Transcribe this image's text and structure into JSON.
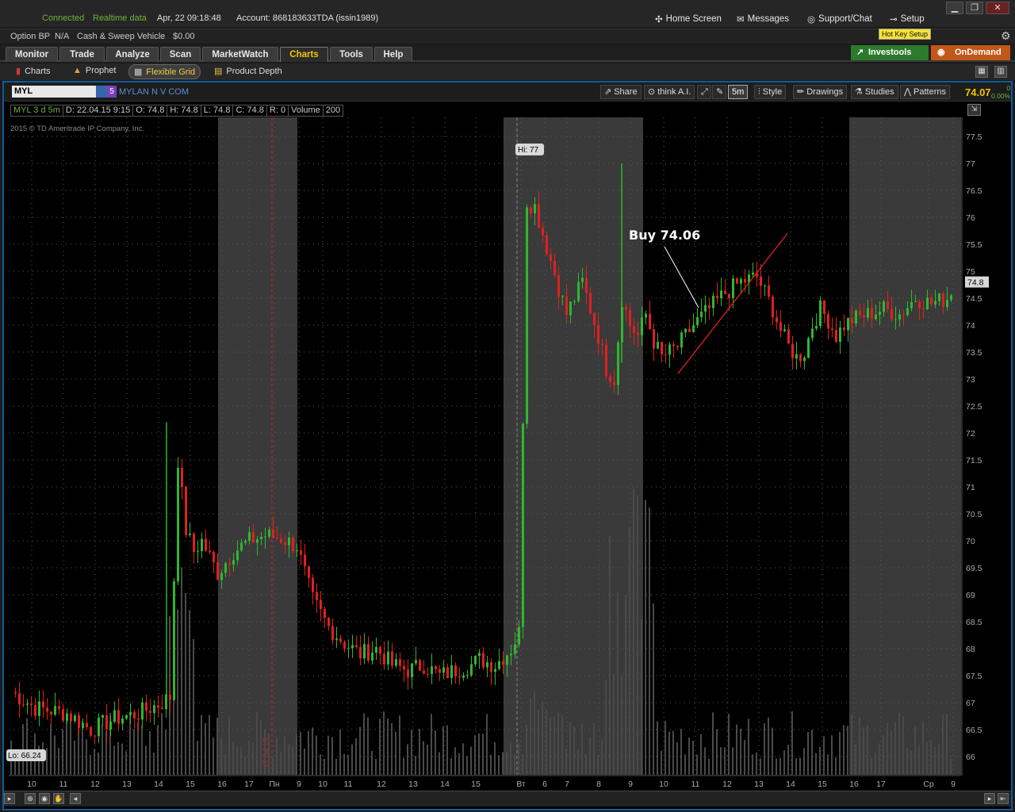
{
  "status": {
    "connected": "Connected",
    "realtime": "Realtime data",
    "datetime": "Apr, 22  09:18:48",
    "account": "Account: 868183633TDA (issin1989)"
  },
  "header_buttons": {
    "home": "Home Screen",
    "messages": "Messages",
    "support": "Support/Chat",
    "setup": "Setup"
  },
  "balance": {
    "option_bp_label": "Option BP",
    "option_bp_value": "N/A",
    "cash_label": "Cash & Sweep Vehicle",
    "cash_value": "$0.00",
    "hotkey": "Hot Key Setup"
  },
  "tabs": [
    "Monitor",
    "Trade",
    "Analyze",
    "Scan",
    "MarketWatch",
    "Charts",
    "Tools",
    "Help"
  ],
  "active_tab": "Charts",
  "ext_buttons": {
    "investools": "Investools",
    "ondemand": "OnDemand"
  },
  "subtabs": [
    "Charts",
    "Prophet",
    "Flexible Grid",
    "Product Depth"
  ],
  "chart_toolbar": {
    "symbol": "MYL",
    "symbol_badge": "5",
    "symbol_name": "MYLAN N V COM",
    "share": "Share",
    "thinkai": "think A.I.",
    "timeframe": "5m",
    "style": "Style",
    "drawings": "Drawings",
    "studies": "Studies",
    "patterns": "Patterns",
    "last_price": "74.07",
    "change": "0",
    "change_pct": "0.00%"
  },
  "ohlc_bar": {
    "label": "MYL 3 d 5m",
    "date": "D: 22.04.15 9:15",
    "open": "O: 74.8",
    "high": "H: 74.8",
    "low": "L: 74.8",
    "close": "C: 74.8",
    "range": "R: 0",
    "volume_label": "Volume",
    "volume_value": "200"
  },
  "copyright": "2015 © TD Ameritrade IP Company, Inc.",
  "chart_data": {
    "type": "candlestick",
    "symbol": "MYL",
    "interval": "5m",
    "y_ticks": [
      66,
      66.5,
      67,
      67.5,
      68,
      68.5,
      69,
      69.5,
      70,
      70.5,
      71,
      71.5,
      72,
      72.5,
      73,
      73.5,
      74,
      74.5,
      75,
      75.5,
      76,
      76.5,
      77,
      77.5
    ],
    "ylim": [
      65.7,
      78
    ],
    "x_ticks": [
      "10",
      "11",
      "12",
      "13",
      "14",
      "15",
      "16",
      "17",
      "Пн",
      "9",
      "10",
      "11",
      "12",
      "13",
      "14",
      "15",
      "Вт",
      "6",
      "7",
      "8",
      "9",
      "10",
      "11",
      "12",
      "13",
      "14",
      "15",
      "16",
      "17",
      "Ср",
      "9"
    ],
    "date_marker": "17.04.15",
    "hi_label": "Hi: 77",
    "lo_label": "Lo: 66.24",
    "current_price_label": "74.8",
    "annotation": "Buy 74.06",
    "close_path": [
      [
        0,
        67.2
      ],
      [
        3,
        66.9
      ],
      [
        7,
        66.8
      ],
      [
        10,
        66.5
      ],
      [
        13,
        66.7
      ],
      [
        16,
        66.8
      ],
      [
        19,
        67.0
      ],
      [
        20,
        67.1
      ],
      [
        21,
        71.5
      ],
      [
        22,
        70.2
      ],
      [
        23,
        69.8
      ],
      [
        24,
        70.0
      ],
      [
        26,
        69.4
      ],
      [
        28,
        69.8
      ],
      [
        30,
        70.0
      ],
      [
        32,
        70.1
      ],
      [
        34,
        70.05
      ],
      [
        36,
        69.9
      ],
      [
        37,
        69.4
      ],
      [
        38,
        68.9
      ],
      [
        40,
        68.4
      ],
      [
        42,
        68.1
      ],
      [
        44,
        67.9
      ],
      [
        46,
        68.0
      ],
      [
        48,
        67.7
      ],
      [
        50,
        67.6
      ],
      [
        52,
        67.7
      ],
      [
        54,
        67.5
      ],
      [
        56,
        67.6
      ],
      [
        58,
        67.7
      ],
      [
        59,
        67.8
      ],
      [
        61,
        67.7
      ],
      [
        63,
        68.0
      ],
      [
        64,
        68.3
      ],
      [
        65,
        76.3
      ],
      [
        66,
        76.2
      ],
      [
        68,
        75.2
      ],
      [
        70,
        74.2
      ],
      [
        72,
        74.8
      ],
      [
        74,
        73.8
      ],
      [
        75,
        73.2
      ],
      [
        76,
        73.0
      ],
      [
        77,
        74.5
      ],
      [
        78,
        74.0
      ],
      [
        79,
        73.8
      ],
      [
        80,
        74.2
      ],
      [
        81,
        73.7
      ],
      [
        82,
        73.4
      ],
      [
        84,
        73.6
      ],
      [
        86,
        74.0
      ],
      [
        88,
        74.3
      ],
      [
        90,
        74.6
      ],
      [
        92,
        74.8
      ],
      [
        94,
        74.9
      ],
      [
        95,
        74.6
      ],
      [
        96,
        74.3
      ],
      [
        97,
        73.9
      ],
      [
        98,
        73.6
      ],
      [
        99,
        73.4
      ],
      [
        100,
        73.5
      ],
      [
        101,
        74.0
      ],
      [
        102,
        74.3
      ],
      [
        103,
        74.1
      ],
      [
        104,
        73.8
      ],
      [
        105,
        74.0
      ],
      [
        106,
        74.1
      ],
      [
        108,
        74.2
      ],
      [
        110,
        74.3
      ],
      [
        112,
        74.2
      ],
      [
        114,
        74.5
      ],
      [
        116,
        74.4
      ],
      [
        118,
        74.5
      ],
      [
        119,
        74.8
      ]
    ]
  }
}
